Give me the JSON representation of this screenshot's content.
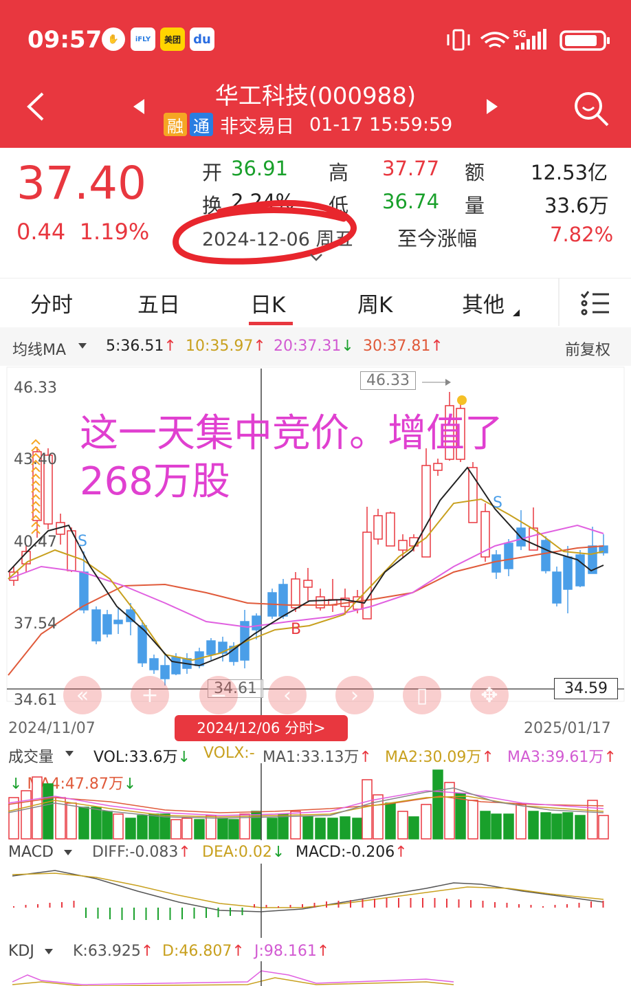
{
  "status": {
    "time": "09:57",
    "icons": [
      "stop-hand-icon",
      "ifly-app-icon",
      "meituan-app-icon",
      "baidu-app-icon"
    ],
    "network": "5G"
  },
  "header": {
    "title": "华工科技(000988)",
    "badge1": "融",
    "badge2": "通",
    "market_status": "非交易日",
    "datetime": "01-17 15:59:59"
  },
  "quote": {
    "price": "37.40",
    "change": "0.44",
    "change_pct": "1.19%",
    "open_label": "开",
    "open": "36.91",
    "high_label": "高",
    "high": "37.77",
    "amount_label": "额",
    "amount": "12.53亿",
    "turnover_label": "换",
    "turnover": "2.24%",
    "low_label": "低",
    "low": "36.74",
    "volume_label": "量",
    "volume": "33.6万",
    "date": "2024-12-06 周五",
    "since_label": "至今涨幅",
    "since": "7.82%"
  },
  "tabs": [
    "分时",
    "五日",
    "日K",
    "周K",
    "其他"
  ],
  "active_tab": "日K",
  "ma_row": {
    "label": "均线MA",
    "ma5": "5:36.51",
    "ma10": "10:35.97",
    "ma20": "20:37.31",
    "ma30": "30:37.81",
    "adjust": "前复权"
  },
  "kchart": {
    "y_labels": [
      "46.33",
      "43.40",
      "40.47",
      "37.54",
      "34.61"
    ],
    "high_tag": "46.33",
    "low_tag": "34.61",
    "cursor_price": "34.59",
    "date_start": "2024/11/07",
    "date_cursor": "2024/12/06 分时>",
    "date_end": "2025/01/17",
    "annotation_line1": "这一天集中竞价。增值了",
    "annotation_line2": "268万股",
    "marks": {
      "s1": "S",
      "s2": "S",
      "b": "B"
    }
  },
  "volume": {
    "label": "成交量",
    "vol": "VOL:33.6万",
    "volx": "VOLX:-",
    "ma1": "MA1:33.13万",
    "ma2": "MA2:30.09万",
    "ma3": "MA3:39.61万",
    "ma4": "MA4:47.87万"
  },
  "macd": {
    "label": "MACD",
    "diff": "DIFF:-0.083",
    "dea": "DEA:0.02",
    "macd": "MACD:-0.206"
  },
  "kdj": {
    "label": "KDJ",
    "k": "K:63.925",
    "d": "D:46.807",
    "j": "J:98.161"
  },
  "arrows": {
    "up": "↑",
    "down": "↓"
  },
  "colors": {
    "brand": "#e8373f",
    "up": "#e8373f",
    "down_candle": "#4a9ee8",
    "down_volume": "#19a02b",
    "ma5": "#222222",
    "ma10": "#c8a01e",
    "ma20": "#e060e0",
    "ma30": "#e05a3a",
    "annotation": "#e040d0"
  }
}
